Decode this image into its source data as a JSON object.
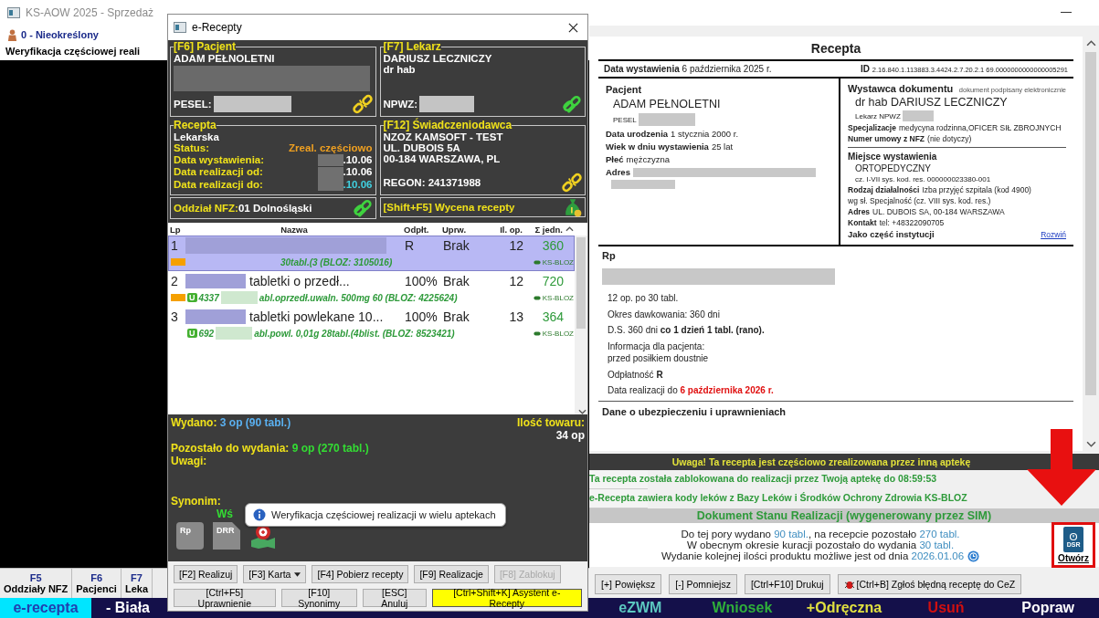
{
  "app": {
    "title": "KS-AOW 2025 - Sprzedaż",
    "user": "0 - Nieokreślony",
    "notice": "Weryfikacja częściowej reali"
  },
  "fkeys": [
    {
      "key": "F5",
      "label": "Oddziały NFZ"
    },
    {
      "key": "F6",
      "label": "Pacjenci"
    },
    {
      "key": "F7",
      "label": "Leka"
    }
  ],
  "bottom_tabs": [
    {
      "label": "e-recepta",
      "selected": true,
      "color": "#2040b0"
    },
    {
      "label": "- Biała",
      "selected": false,
      "color": "#ffffff"
    },
    {
      "label": "eZWM",
      "selected": false,
      "color": "#5cc8c0"
    },
    {
      "label": "Wniosek",
      "selected": false,
      "color": "#2fae3a"
    },
    {
      "label": "+Odręczna",
      "selected": false,
      "color": "#e0e040"
    },
    {
      "label": "Usuń",
      "selected": false,
      "color": "#d01010"
    },
    {
      "label": "Popraw",
      "selected": false,
      "color": "#ffffff"
    }
  ],
  "dialog": {
    "title": "e-Recepty",
    "patient": {
      "heading": "[F6] Pacjent",
      "name": "ADAM PEŁNOLETNI",
      "pesel_label": "PESEL:",
      "linked": false
    },
    "doctor": {
      "heading": "[F7] Lekarz",
      "name": "DARIUSZ LECZNICZY",
      "degree": "dr hab",
      "npwz_label": "NPWZ:",
      "linked": true
    },
    "prescription": {
      "heading": "Recepta",
      "type": "Lekarska",
      "fields": [
        {
          "label": "Status:",
          "value": "Zreal. częściowo",
          "color": "#f0a020",
          "redacted": false
        },
        {
          "label": "Data wystawienia:",
          "value": ".10.06",
          "color": "#ffffff",
          "redacted": true
        },
        {
          "label": "Data realizacji od:",
          "value": ".10.06",
          "color": "#ffffff",
          "redacted": true
        },
        {
          "label": "Data realizacji do:",
          "value": ".10.06",
          "color": "#40d0e0",
          "redacted": true
        }
      ]
    },
    "provider": {
      "heading": "[F12] Świadczeniodawca",
      "lines": [
        "NZOZ KAMSOFT - TEST",
        "UL. DUBOIS 5A",
        "00-184 WARSZAWA, PL"
      ],
      "regon": "REGON: 241371988",
      "linked": false
    },
    "nfz": {
      "label": "Oddział NFZ:",
      "value": "01 Dolnośląski",
      "linked": true
    },
    "pricing": "[Shift+F5] Wycena recepty",
    "columns": [
      "Lp",
      "Nazwa",
      "Odpłt.",
      "Uprw.",
      "Il. op.",
      "Σ jedn."
    ],
    "rows": [
      {
        "lp": "1",
        "payment": "R",
        "entitlement": "Brak",
        "packs": "12",
        "units": "360",
        "detail": "30tabl.(3 (BLOZ: 3105016)",
        "source": "KS-BLOZ",
        "selected": true,
        "flagged": true
      },
      {
        "lp": "2",
        "name": "tabletki o przedł...",
        "payment": "100%",
        "entitlement": "Brak",
        "packs": "12",
        "units": "720",
        "badge": "U",
        "code": "4337",
        "detail": "abl.oprzedł.uwaln. 500mg 60 (BLOZ: 4225624)",
        "source": "KS-BLOZ",
        "selected": false,
        "flagged": true
      },
      {
        "lp": "3",
        "name": "tabletki powlekane 10...",
        "payment": "100%",
        "entitlement": "Brak",
        "packs": "13",
        "units": "364",
        "badge": "U",
        "code": "692",
        "detail": "abl.powl. 0,01g 28tabl.(4blist. (BLOZ: 8523421)",
        "source": "KS-BLOZ",
        "selected": false,
        "flagged": false
      }
    ],
    "issued_label": "Wydano:",
    "issued": "3 op (90 tabl.)",
    "stock_label": "Ilość towaru:",
    "stock": "34 op",
    "remaining_label": "Pozostało do wydania:",
    "remaining": "9 op (270 tabl.)",
    "notes_label": "Uwagi:",
    "synonym_label": "Synonim:",
    "synonym": "Wś",
    "icon_labels": [
      "Rp",
      "DRR"
    ],
    "tooltip": "Weryfikacja częściowej realizacji w wielu aptekach",
    "buttons": [
      [
        {
          "label": "[F2] Realizuj",
          "menu": false,
          "disabled": false,
          "highlighted": false
        },
        {
          "label": "[F3] Karta",
          "menu": true,
          "disabled": false,
          "highlighted": false
        },
        {
          "label": "[F4] Pobierz recepty",
          "menu": false,
          "disabled": false,
          "highlighted": false
        },
        {
          "label": "[F9] Realizacje",
          "menu": false,
          "disabled": false,
          "highlighted": false
        },
        {
          "label": "[F8] Zablokuj",
          "menu": false,
          "disabled": true,
          "highlighted": false
        }
      ],
      [
        {
          "label": "[Ctrl+F5] Uprawnienie",
          "menu": false,
          "disabled": false,
          "highlighted": false
        },
        {
          "label": "[F10] Synonimy",
          "menu": false,
          "disabled": false,
          "highlighted": false
        },
        {
          "label": "[ESC] Anuluj",
          "menu": false,
          "disabled": false,
          "highlighted": false
        },
        {
          "label": "[Ctrl+Shift+K] Asystent e-Recepty",
          "menu": false,
          "disabled": false,
          "highlighted": true
        }
      ]
    ]
  },
  "document": {
    "title": "Recepta",
    "date_label": "Data wystawienia",
    "date": "6 października 2025 r.",
    "id_label": "ID",
    "id": "2.16.840.1.113883.3.4424.2.7.20.2.1 69.0000000000000005291",
    "patient": {
      "heading": "Pacjent",
      "name": "ADAM PEŁNOLETNI",
      "pesel_label": "PESEL",
      "fields": [
        {
          "label": "Data urodzenia",
          "value": "1 stycznia 2000 r."
        },
        {
          "label": "Wiek w dniu wystawienia",
          "value": "25 lat"
        },
        {
          "label": "Płeć",
          "value": "mężczyzna"
        }
      ],
      "address_label": "Adres"
    },
    "issuer": {
      "heading": "Wystawca dokumentu",
      "note": "dokument podpisany elektronicznie",
      "name": "dr hab DARIUSZ LECZNICZY",
      "role": "Lekarz NPWZ",
      "fields": [
        {
          "label": "Specjalizacje",
          "value": "medycyna rodzinna,OFICER SIŁ ZBROJNYCH"
        },
        {
          "label": "Numer umowy z NFZ",
          "value": "(nie dotyczy)"
        }
      ]
    },
    "place": {
      "heading": "Miejsce wystawienia",
      "name": "ORTOPEDYCZNY",
      "code": "cz. I-VII sys. kod. res. 000000023380-001",
      "activity_label": "Rodzaj działalności",
      "activity": "Izba przyjęć szpitala (kod 4900)",
      "activity_note": "wg sł. Specjalność (cz. VIII sys. kod. res.)",
      "fields": [
        {
          "label": "Adres",
          "value": "UL. DUBOIS SA, 00-184 WARSZAWA"
        },
        {
          "label": "Kontakt",
          "value": "tel: +48322090705"
        }
      ],
      "institution_label": "Jako część instytucji",
      "expand_link": "Rozwiń"
    },
    "rp": {
      "heading": "Rp",
      "lines": [
        "12 op. po 30 tabl.",
        "Okres dawkowania: 360 dni",
        "D.S. 360 dni **co 1 dzień 1 tabl. (rano).**"
      ],
      "info": [
        "Informacja dla pacjenta:",
        "przed posiłkiem doustnie"
      ],
      "payment": "Odpłatność **R**",
      "deadline_label": "Data realizacji do",
      "deadline": "6 października 2026 r."
    },
    "insurance_heading": "Dane o ubezpieczeniu i uprawnieniach"
  },
  "messages": [
    {
      "kind": "warning",
      "text": "Uwaga! Ta recepta jest częściowo zrealizowana przez inną aptekę"
    },
    {
      "kind": "info",
      "text": "Ta recepta została zablokowana do realizacji przez Twoją aptekę do 08:59:53"
    },
    {
      "kind": "info",
      "text": "e-Recepta zawiera kody leków z Bazy Leków i Środków Ochrony Zdrowia KS-BLOZ"
    },
    {
      "kind": "header",
      "text": "Dokument Stanu Realizacji (wygenerowany przez SIM)"
    }
  ],
  "dsr": {
    "lines": [
      [
        {
          "text": "Do tej pory wydano ",
          "emphasis": false
        },
        {
          "text": "90 tabl.",
          "emphasis": true
        },
        {
          "text": ", na recepcie pozostało ",
          "emphasis": false
        },
        {
          "text": "270 tabl.",
          "emphasis": true
        }
      ],
      [
        {
          "text": "W obecnym okresie kuracji pozostało do wydania ",
          "emphasis": false
        },
        {
          "text": "30 tabl.",
          "emphasis": true
        }
      ],
      [
        {
          "text": "Wydanie kolejnej ilości produktu możliwe jest od dnia ",
          "emphasis": false
        },
        {
          "text": "2026.01.06",
          "emphasis": true
        }
      ]
    ],
    "icon_label": "DSR",
    "open": "Otwórz"
  },
  "toolbar": [
    "[+] Powiększ",
    "[-] Pomniejsz",
    "[Ctrl+F10] Drukuj",
    "[Ctrl+B] Zgłoś błędną receptę do CeZ"
  ]
}
